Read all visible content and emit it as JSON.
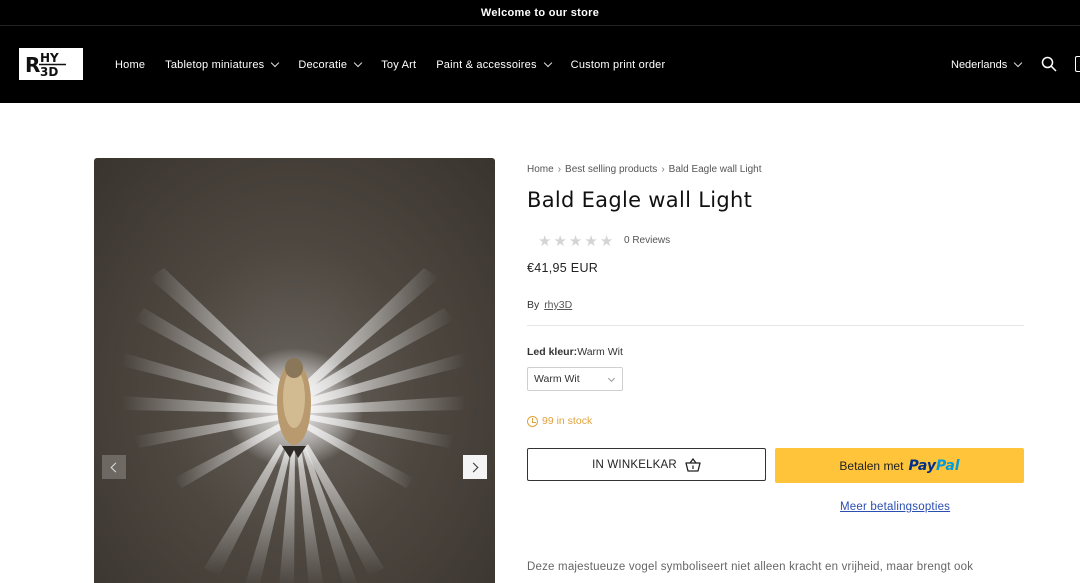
{
  "announcement": "Welcome to our store",
  "logo": {
    "line1": "HY",
    "letter": "R",
    "line2": "3D"
  },
  "nav": {
    "items": [
      {
        "label": "Home",
        "has_dropdown": false
      },
      {
        "label": "Tabletop miniatures",
        "has_dropdown": true
      },
      {
        "label": "Decoratie",
        "has_dropdown": true
      },
      {
        "label": "Toy Art",
        "has_dropdown": false
      },
      {
        "label": "Paint & accessoires",
        "has_dropdown": true
      },
      {
        "label": "Custom print order",
        "has_dropdown": false
      }
    ],
    "language": "Nederlands",
    "icons": [
      "search-icon",
      "cart-icon"
    ]
  },
  "breadcrumb": {
    "items": [
      "Home",
      "Best selling products",
      "Bald Eagle wall Light"
    ],
    "separator": "›"
  },
  "product": {
    "title": "Bald Eagle wall Light",
    "rating": 0,
    "rating_max": 5,
    "reviews": "0 Reviews",
    "price": "€41,95 EUR",
    "by_label": "By",
    "vendor": "rhy3D",
    "option_label": "Led kleur:",
    "option_value": "Warm Wit",
    "select_value": "Warm Wit",
    "stock": "99 in stock",
    "add_to_cart": "IN WINKELKAR",
    "paypal_prefix": "Betalen met",
    "paypal_brand_1": "Pay",
    "paypal_brand_2": "Pal",
    "more_payment": "Meer betalingsopties",
    "description": "Deze majestueuze vogel symboliseert niet alleen kracht en vrijheid, maar brengt ook"
  },
  "colors": {
    "header_bg": "#000000",
    "paypal_yellow": "#ffc439",
    "stock_color": "#e2a23a",
    "link_blue": "#2b4fb0"
  }
}
